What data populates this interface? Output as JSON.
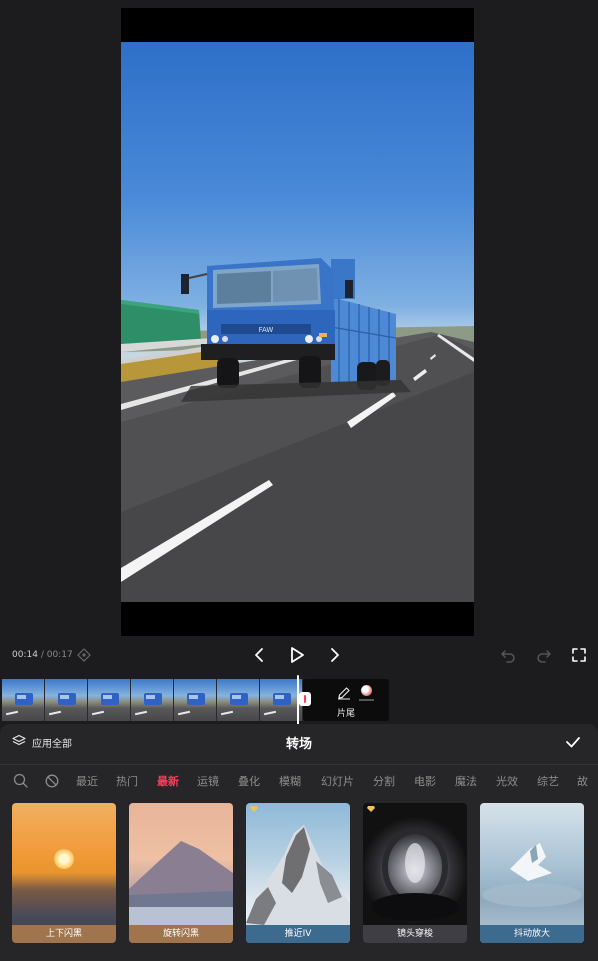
{
  "playback": {
    "current_time": "00:14",
    "separator": "/",
    "total_time": "00:17"
  },
  "timeline": {
    "clip_thumbnail_count": 7,
    "ending_label": "片尾"
  },
  "panel": {
    "apply_all_label": "应用全部",
    "title": "转场",
    "categories": [
      "最近",
      "热门",
      "最新",
      "运镜",
      "叠化",
      "模糊",
      "幻灯片",
      "分割",
      "电影",
      "魔法",
      "光效",
      "综艺",
      "故"
    ],
    "active_category": "最新",
    "transitions": [
      {
        "label": "上下闪黑",
        "badge": false
      },
      {
        "label": "旋转闪黑",
        "badge": false
      },
      {
        "label": "推近IV",
        "badge": true
      },
      {
        "label": "镜头穿梭",
        "badge": true
      },
      {
        "label": "抖动放大",
        "badge": false
      }
    ]
  },
  "colors": {
    "accent": "#ff3b5c",
    "panel_bg": "#262628",
    "app_bg": "#1c1c1e"
  },
  "icons": {
    "keyframe": "diamond-icon",
    "prev": "chevron-left-icon",
    "play": "play-icon",
    "next": "chevron-right-icon",
    "undo": "undo-icon",
    "redo": "redo-icon",
    "fullscreen": "fullscreen-icon",
    "apply_all": "layers-icon",
    "confirm": "check-icon",
    "search": "search-icon",
    "none": "none-icon"
  }
}
